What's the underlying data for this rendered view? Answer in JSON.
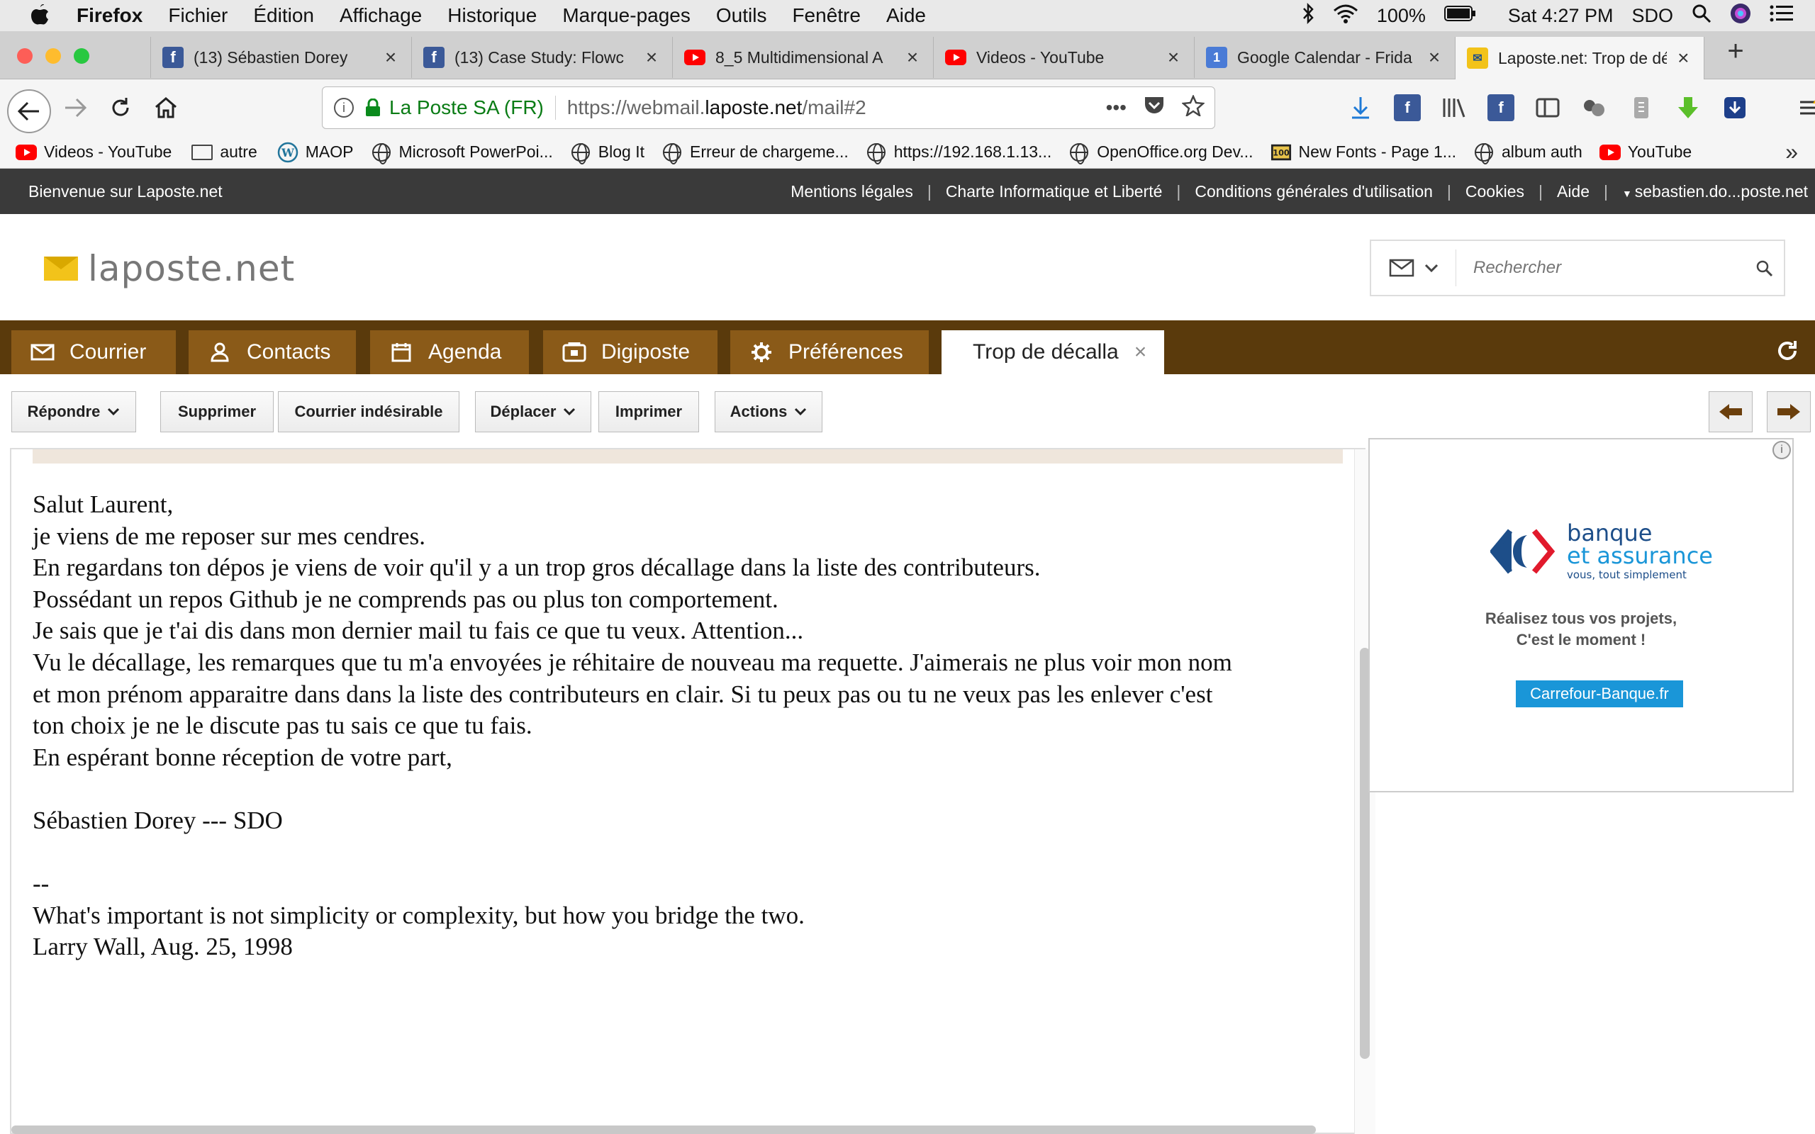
{
  "menubar": {
    "app": "Firefox",
    "items": [
      "Fichier",
      "Édition",
      "Affichage",
      "Historique",
      "Marque-pages",
      "Outils",
      "Fenêtre",
      "Aide"
    ],
    "battery": "100%",
    "clock": "Sat 4:27 PM",
    "user": "SDO"
  },
  "tabs": [
    {
      "label": "(13) Sébastien Dorey",
      "icon": "facebook-icon"
    },
    {
      "label": "(13) Case Study: Flowc",
      "icon": "facebook-icon"
    },
    {
      "label": "8_5 Multidimensional A",
      "icon": "youtube-icon"
    },
    {
      "label": "Videos - YouTube",
      "icon": "youtube-icon"
    },
    {
      "label": "Google Calendar - Frida",
      "icon": "calendar-icon"
    },
    {
      "label": "Laposte.net: Trop de dé",
      "icon": "laposte-icon",
      "active": true
    }
  ],
  "navbar": {
    "org": "La Poste SA (FR)",
    "url_prefix": "https://webmail.",
    "url_domain": "laposte.net",
    "url_path": "/mail#2"
  },
  "bookmarks": [
    {
      "label": "Videos - YouTube",
      "icon": "youtube-icon"
    },
    {
      "label": "autre",
      "icon": "folder-icon"
    },
    {
      "label": "MAOP",
      "icon": "wordpress-icon"
    },
    {
      "label": "Microsoft PowerPoi...",
      "icon": "globe-icon"
    },
    {
      "label": "Blog It",
      "icon": "globe-icon"
    },
    {
      "label": "Erreur de chargeme...",
      "icon": "globe-icon"
    },
    {
      "label": "https://192.168.1.13...",
      "icon": "globe-icon"
    },
    {
      "label": "OpenOffice.org Dev...",
      "icon": "globe-icon"
    },
    {
      "label": "New Fonts - Page 1...",
      "icon": "fonts-icon"
    },
    {
      "label": "album auth",
      "icon": "globe-icon"
    },
    {
      "label": "YouTube",
      "icon": "youtube-icon"
    }
  ],
  "site_top": {
    "welcome": "Bienvenue sur Laposte.net",
    "links": [
      "Mentions légales",
      "Charte Informatique et Liberté",
      "Conditions générales d'utilisation",
      "Cookies",
      "Aide"
    ],
    "account": "sebastien.do...poste.net"
  },
  "header": {
    "logo_text": "laposte.net",
    "search_placeholder": "Rechercher"
  },
  "nav": {
    "tabs": [
      {
        "label": "Courrier",
        "icon": "envelope-icon"
      },
      {
        "label": "Contacts",
        "icon": "person-icon"
      },
      {
        "label": "Agenda",
        "icon": "calendar-icon"
      },
      {
        "label": "Digiposte",
        "icon": "digiposte-icon"
      },
      {
        "label": "Préférences",
        "icon": "gear-icon"
      }
    ],
    "active_tab": "Trop de décalla"
  },
  "toolbar": {
    "reply": "Répondre",
    "delete": "Supprimer",
    "spam": "Courrier indésirable",
    "move": "Déplacer",
    "print": "Imprimer",
    "actions": "Actions"
  },
  "message": {
    "lines": [
      "Salut Laurent,",
      "je viens de me reposer sur mes cendres.",
      "En regardans ton dépos je viens de voir qu'il y a un trop gros décallage dans la liste des contributeurs.",
      "Possédant un repos Github je ne comprends pas ou plus ton comportement.",
      "Je sais que je t'ai dis dans mon dernier mail tu fais ce que tu veux. Attention...",
      "Vu le décallage, les remarques que tu m'a envoyées je réhitaire de nouveau ma requette. J'aimerais ne plus voir mon nom",
      "et mon prénom apparaitre dans dans la liste des contributeurs en clair. Si tu peux pas ou tu ne veux pas les enlever c'est",
      "ton choix je ne le discute pas tu sais ce que tu fais.",
      "En espérant bonne réception de votre part,",
      "",
      "Sébastien Dorey --- SDO",
      "",
      "--",
      "What's important is not simplicity or complexity, but how you bridge the two.",
      "Larry Wall, Aug. 25, 1998"
    ]
  },
  "ad": {
    "brand_line1": "banque",
    "brand_line2": "et assurance",
    "brand_tagline": "vous, tout simplement",
    "text_line1": "Réalisez tous vos projets,",
    "text_line2": "C'est le moment !",
    "cta": "Carrefour-Banque.fr"
  },
  "colors": {
    "nav_bg": "#5a3a0c",
    "nav_tab": "#8a5a18",
    "top_bar": "#3a3a3a",
    "accent_blue": "#1a96d8"
  }
}
